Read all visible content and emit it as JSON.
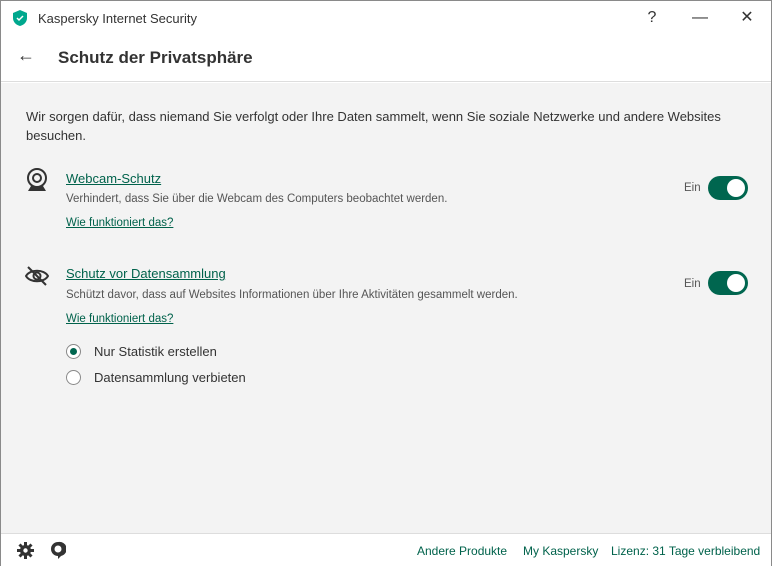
{
  "window": {
    "title": "Kaspersky Internet Security",
    "help": "?",
    "minimize": "—",
    "close": "✕"
  },
  "header": {
    "back": "←",
    "title": "Schutz der Privatsphäre"
  },
  "intro": "Wir sorgen dafür, dass niemand Sie verfolgt oder Ihre Daten sammelt, wenn Sie soziale Netzwerke und andere Websites besuchen.",
  "features": [
    {
      "title": "Webcam-Schutz",
      "desc": "Verhindert, dass Sie über die Webcam des Computers beobachtet werden.",
      "link": "Wie funktioniert das?",
      "state": "Ein",
      "enabled": true
    },
    {
      "title": "Schutz vor Datensammlung",
      "desc": "Schützt davor, dass auf Websites Informationen über Ihre Aktivitäten gesammelt werden.",
      "link": "Wie funktioniert das?",
      "state": "Ein",
      "enabled": true
    }
  ],
  "options": [
    {
      "label": "Nur Statistik erstellen",
      "selected": true
    },
    {
      "label": "Datensammlung verbieten",
      "selected": false
    }
  ],
  "footer": {
    "links": [
      "Andere Produkte",
      "My Kaspersky",
      "Lizenz: 31 Tage verbleibend"
    ]
  },
  "colors": {
    "accent": "#00664f"
  }
}
